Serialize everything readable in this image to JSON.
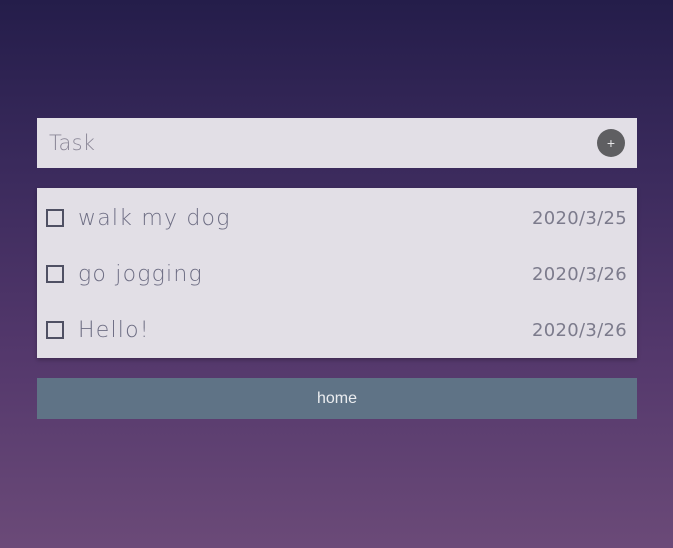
{
  "task_input": {
    "placeholder": "Task",
    "value": "",
    "add_button_label": "+"
  },
  "tasks": [
    {
      "name": "walk my dog",
      "date": "2020/3/25",
      "checked": false
    },
    {
      "name": "go jogging",
      "date": "2020/3/26",
      "checked": false
    },
    {
      "name": "Hello!",
      "date": "2020/3/26",
      "checked": false
    }
  ],
  "footer": {
    "home_label": "home"
  },
  "colors": {
    "background_top": "#241d4a",
    "background_bottom": "#6b4a78",
    "panel": "#e2dfe6",
    "add_button": "#5f5f62",
    "home_button": "#5f7386"
  }
}
